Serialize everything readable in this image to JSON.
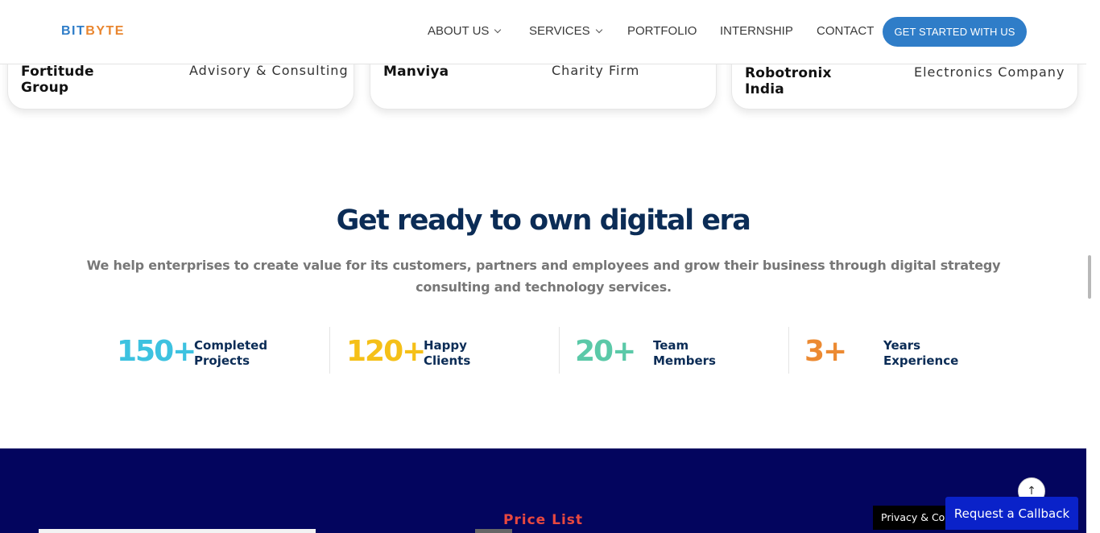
{
  "header": {
    "logo_part1": "BIT",
    "logo_part2": "BYTE",
    "nav": {
      "about": "ABOUT US",
      "services": "SERVICES",
      "portfolio": "PORTFOLIO",
      "internship": "INTERNSHIP",
      "contact": "CONTACT"
    },
    "cta_label": "GET STARTED WITH US"
  },
  "clients": [
    {
      "name": "Fortitude Group",
      "type": "Advisory & Consulting"
    },
    {
      "name": "Manviya",
      "type": "Charity Firm"
    },
    {
      "name": "Robotronix India",
      "type": "Electronics Company"
    }
  ],
  "hero": {
    "headline": "Get ready to own digital era",
    "subtext": "We help enterprises to create value for its customers, partners and employees and grow their business through digital strategy consulting and technology services."
  },
  "stats": [
    {
      "number": "150+",
      "label": "Completed Projects",
      "color": "#3dc2e0"
    },
    {
      "number": "120+",
      "label": "Happy Clients",
      "color": "#f5c018"
    },
    {
      "number": "20+",
      "label": "Team Members",
      "color": "#5bc9a8"
    },
    {
      "number": "3+",
      "label": "Years Experience",
      "color": "#ec8a32"
    }
  ],
  "pricing": {
    "title": "Price List"
  },
  "widgets": {
    "scroll_top_icon": "↑",
    "privacy_label": "Privacy & Cookies",
    "callback_label": "Request a Callback"
  },
  "colors": {
    "brand_blue": "#2f7dc8",
    "brand_orange": "#e9862f",
    "heading_navy": "#0b2c56",
    "dark_section": "#03055e",
    "price_title": "#e8483f",
    "callback_blue": "#0a22c9"
  }
}
